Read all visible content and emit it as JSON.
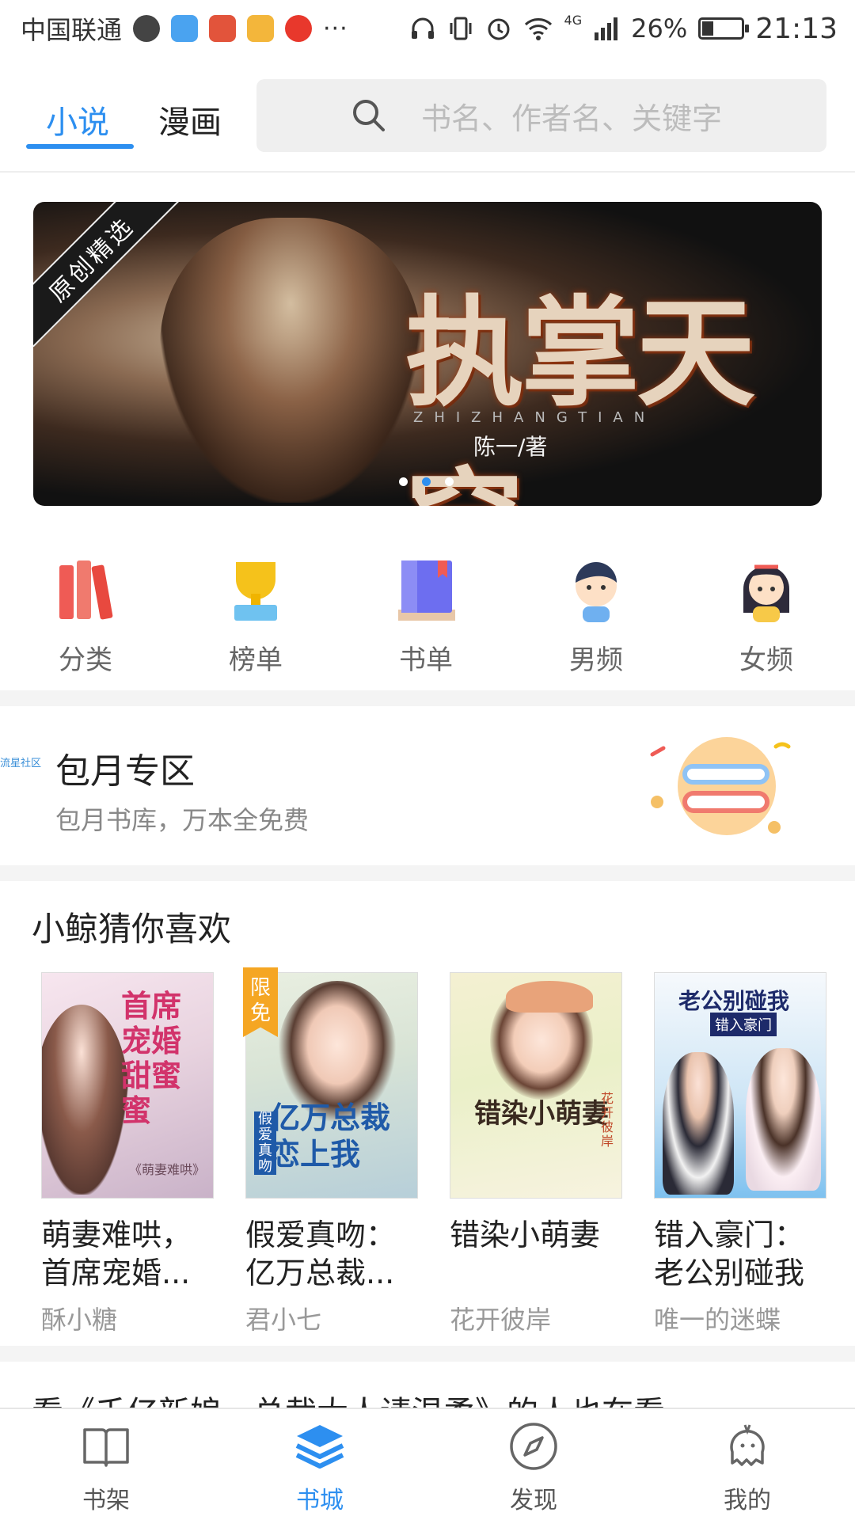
{
  "statusbar": {
    "carrier": "中国联通",
    "network": "4G",
    "battery": "26%",
    "battery_level": 0.26,
    "time": "21:13",
    "overflow": "···"
  },
  "top_tabs": [
    {
      "label": "小说",
      "active": true
    },
    {
      "label": "漫画",
      "active": false
    }
  ],
  "search": {
    "placeholder": "书名、作者名、关键字"
  },
  "banner": {
    "ribbon": "原创精选",
    "title": "执掌天穹",
    "pinyin": "ZHIZHANGTIAN",
    "author": "陈一/著",
    "page_count": 3,
    "active_page": 2
  },
  "categories": [
    {
      "label": "分类",
      "icon": "books-icon"
    },
    {
      "label": "榜单",
      "icon": "trophy-icon"
    },
    {
      "label": "书单",
      "icon": "booklist-icon"
    },
    {
      "label": "男频",
      "icon": "boy-icon"
    },
    {
      "label": "女频",
      "icon": "girl-icon"
    }
  ],
  "monthly": {
    "community_tag": "流星社区",
    "title": "包月专区",
    "subtitle": "包月书库，万本全免费"
  },
  "guess": {
    "title": "小鲸猜你喜欢",
    "books": [
      {
        "title": "萌妻难哄，首席宠婚...",
        "author": "酥小糖",
        "cover_text": "首席宠婚甜蜜蜜",
        "cover_sub": "《萌妻难哄》",
        "free": false
      },
      {
        "title": "假爱真吻：亿万总裁...",
        "author": "君小七",
        "cover_text": "亿万总裁恋上我",
        "cover_sub": "假爱真吻",
        "free": true,
        "badge": "限免"
      },
      {
        "title": "错染小萌妻",
        "author": "花开彼岸",
        "cover_text": "错染小萌妻",
        "cover_sub": "花开彼岸",
        "free": false
      },
      {
        "title": "错入豪门：老公别碰我",
        "author": "唯一的迷蝶",
        "cover_text": "老公别碰我",
        "cover_sub": "错入豪门",
        "free": false
      }
    ]
  },
  "peek_text": "看《千亿新娘，总裁大人请温柔》的人也在看",
  "bottom_nav": [
    {
      "label": "书架",
      "icon": "bookshelf-icon",
      "active": false
    },
    {
      "label": "书城",
      "icon": "bookstore-icon",
      "active": true
    },
    {
      "label": "发现",
      "icon": "compass-icon",
      "active": false
    },
    {
      "label": "我的",
      "icon": "profile-icon",
      "active": false
    }
  ],
  "colors": {
    "accent": "#2d8ff0",
    "badge": "#f5a623"
  }
}
